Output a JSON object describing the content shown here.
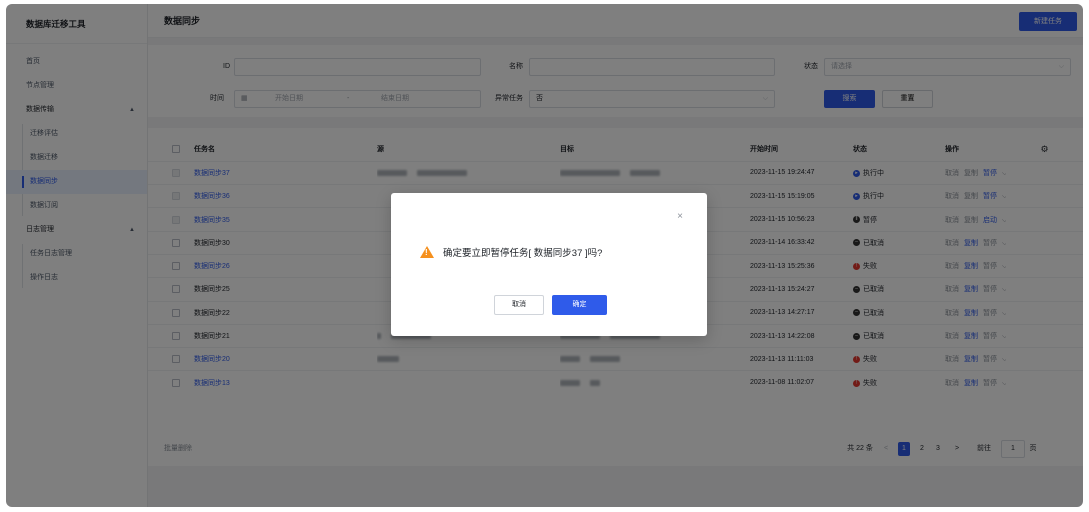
{
  "app": {
    "title": "数据库迁移工具"
  },
  "sidebar": {
    "items": [
      {
        "label": "首页"
      },
      {
        "label": "节点管理"
      },
      {
        "label": "数据传输",
        "arrow": "▲"
      },
      {
        "label": "迁移评估"
      },
      {
        "label": "数据迁移"
      },
      {
        "label": "数据同步"
      },
      {
        "label": "数据订阅"
      },
      {
        "label": "日志管理",
        "arrow": "▲"
      },
      {
        "label": "任务日志管理"
      },
      {
        "label": "操作日志"
      }
    ],
    "collapse_icon": "◂"
  },
  "header": {
    "title": "数据同步",
    "create_label": "新建任务"
  },
  "filter": {
    "id_label": "ID",
    "id_value": "",
    "name_label": "名称",
    "name_value": "",
    "status_label": "状态",
    "status_placeholder": "请选择",
    "time_label": "时间",
    "start_placeholder": "开始日期",
    "range_sep": "-",
    "end_placeholder": "结束日期",
    "abnormal_label": "异常任务",
    "abnormal_value": "否",
    "search_label": "搜索",
    "reset_label": "重置"
  },
  "table": {
    "headers": [
      "任务名",
      "源",
      "目标",
      "开始时间",
      "状态",
      "操作"
    ],
    "rows": [
      {
        "name": "数据同步37",
        "start": "2023-11-15 19:24:47",
        "status": "执行中",
        "ops": [
          "取消",
          "复制",
          "暂停"
        ]
      },
      {
        "name": "数据同步36",
        "start": "2023-11-15 15:19:05",
        "status": "执行中",
        "ops": [
          "取消",
          "复制",
          "暂停"
        ]
      },
      {
        "name": "数据同步35",
        "start": "2023-11-15 10:56:23",
        "status": "暂停",
        "ops": [
          "取消",
          "复制",
          "启动"
        ]
      },
      {
        "name": "数据同步30",
        "start": "2023-11-14 16:33:42",
        "status": "已取消",
        "ops": [
          "取消",
          "复制",
          "暂停"
        ]
      },
      {
        "name": "数据同步26",
        "start": "2023-11-13 15:25:36",
        "status": "失败",
        "ops": [
          "取消",
          "复制",
          "暂停"
        ]
      },
      {
        "name": "数据同步25",
        "start": "2023-11-13 15:24:27",
        "status": "已取消",
        "ops": [
          "取消",
          "复制",
          "暂停"
        ]
      },
      {
        "name": "数据同步22",
        "start": "2023-11-13 14:27:17",
        "status": "已取消",
        "ops": [
          "取消",
          "复制",
          "暂停"
        ]
      },
      {
        "name": "数据同步21",
        "start": "2023-11-13 14:22:08",
        "status": "已取消",
        "ops": [
          "取消",
          "复制",
          "暂停"
        ]
      },
      {
        "name": "数据同步20",
        "start": "2023-11-13 11:11:03",
        "status": "失败",
        "ops": [
          "取消",
          "复制",
          "暂停"
        ]
      },
      {
        "name": "数据同步13",
        "start": "2023-11-08 11:02:07",
        "status": "失败",
        "ops": [
          "取消",
          "复制",
          "暂停"
        ]
      }
    ]
  },
  "pager": {
    "batch_delete": "批量删除",
    "total": "共 22 条",
    "prev": "<",
    "pages": [
      "1",
      "2",
      "3"
    ],
    "next": ">",
    "goto_label": "前往",
    "goto_value": "1",
    "page_unit": "页"
  },
  "dialog": {
    "message": "确定要立即暂停任务[ 数据同步37 ]吗?",
    "cancel_label": "取消",
    "ok_label": "确定",
    "close_icon": "×"
  },
  "colors": {
    "primary": "#2f5bea",
    "running": "#2f5bea",
    "paused": "#333333",
    "cancelled": "#333333",
    "failed": "#e5362e",
    "warning": "#f5901e"
  }
}
